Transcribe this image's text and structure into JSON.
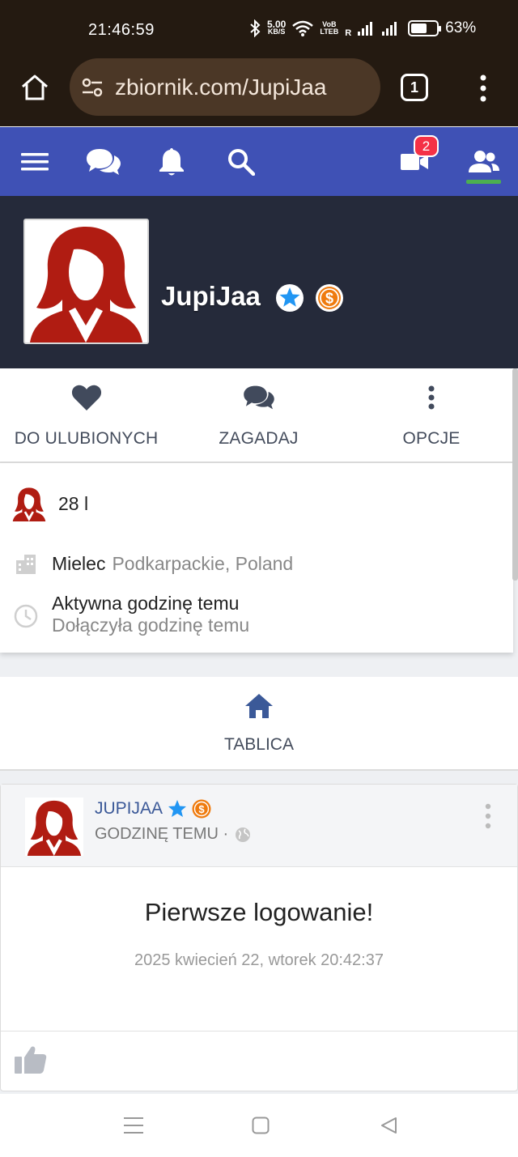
{
  "status_bar": {
    "time": "21:46:59",
    "net_speed_value": "5.00",
    "net_speed_unit": "KB/S",
    "volte_top": "VoB",
    "volte_bottom": "LTEB",
    "roaming": "R",
    "battery": "63%",
    "battery_level": 0.63
  },
  "browser": {
    "url": "zbiornik.com/JupiJaa",
    "tab_count": "1"
  },
  "site_nav": {
    "video_badge": "2",
    "colors": {
      "bar": "#3f51b5",
      "active_indicator": "#4caf50"
    }
  },
  "profile": {
    "username": "JupiJaa",
    "actions": {
      "favorite": "DO ULUBIONYCH",
      "ask": "ZAGADAJ",
      "options": "OPCJE"
    },
    "age": "28 l",
    "city": "Mielec",
    "region": "Podkarpackie, Poland",
    "activity": "Aktywna godzinę temu",
    "joined": "Dołączyła godzinę temu"
  },
  "wall_tab": {
    "label": "TABLICA"
  },
  "post": {
    "author": "JUPIJAA",
    "time": "GODZINĘ TEMU ·",
    "title": "Pierwsze logowanie!",
    "date": "2025 kwiecień 22, wtorek 20:42:37"
  },
  "icons": {
    "status": [
      "bluetooth-icon",
      "wifi-icon",
      "signal-icon",
      "battery-icon"
    ],
    "browser": [
      "home-icon",
      "tune-icon",
      "tabs-icon",
      "more-vert-icon"
    ],
    "site_nav": [
      "menu-icon",
      "chat-icon",
      "bell-icon",
      "search-icon",
      "video-icon",
      "people-icon"
    ]
  }
}
